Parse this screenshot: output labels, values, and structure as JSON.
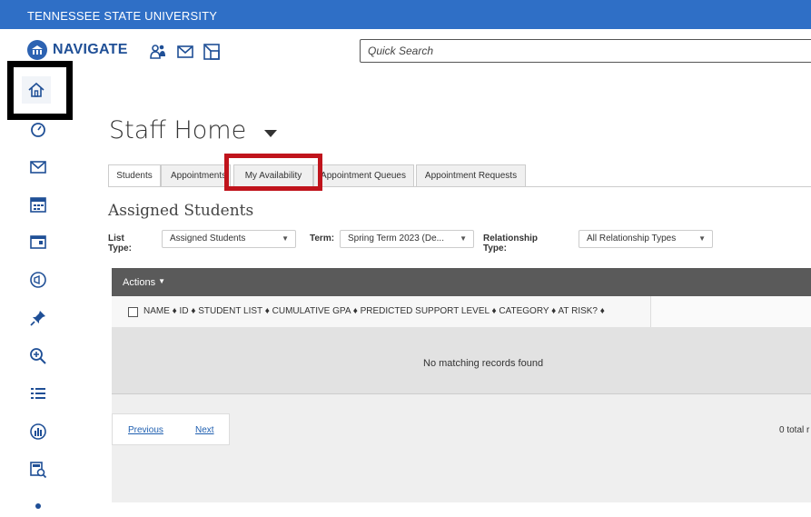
{
  "university": "TENNESSEE STATE UNIVERSITY",
  "brand": "NAVIGATE",
  "search": {
    "placeholder": "Quick Search"
  },
  "page": {
    "title": "Staff Home"
  },
  "tabs": [
    {
      "label": "Students",
      "active": true
    },
    {
      "label": "Appointments",
      "active": false
    },
    {
      "label": "My Availability",
      "active": false
    },
    {
      "label": "Appointment Queues",
      "active": false
    },
    {
      "label": "Appointment Requests",
      "active": false
    }
  ],
  "section": {
    "title": "Assigned Students"
  },
  "filters": {
    "list_type_label": "List Type:",
    "list_type_value": "Assigned Students",
    "term_label": "Term:",
    "term_value": "Spring Term 2023 (De...",
    "relationship_label": "Relationship Type:",
    "relationship_value": "All Relationship Types"
  },
  "table": {
    "actions_label": "Actions",
    "columns": [
      "NAME",
      "ID",
      "STUDENT LIST",
      "CUMULATIVE GPA",
      "PREDICTED SUPPORT LEVEL",
      "CATEGORY",
      "AT RISK?"
    ],
    "columns_text": "NAME ♦  ID ♦  STUDENT LIST ♦  CUMULATIVE GPA ♦  PREDICTED SUPPORT LEVEL ♦  CATEGORY ♦  AT RISK? ♦",
    "empty_message": "No matching records found"
  },
  "pagination": {
    "previous": "Previous",
    "next": "Next",
    "total": "0 total r"
  },
  "icons": {
    "header": [
      "students-icon",
      "mail-icon",
      "export-icon"
    ],
    "sidebar": [
      "home-icon",
      "speedometer-icon",
      "mail-icon",
      "calendar-icon",
      "card-icon",
      "megaphone-icon",
      "pin-icon",
      "zoom-in-icon",
      "list-icon",
      "chart-icon",
      "report-search-icon",
      "user-icon"
    ]
  },
  "colors": {
    "topbar": "#2f6fc6",
    "accent": "#1f4f96",
    "highlight_red": "#c0141c"
  }
}
